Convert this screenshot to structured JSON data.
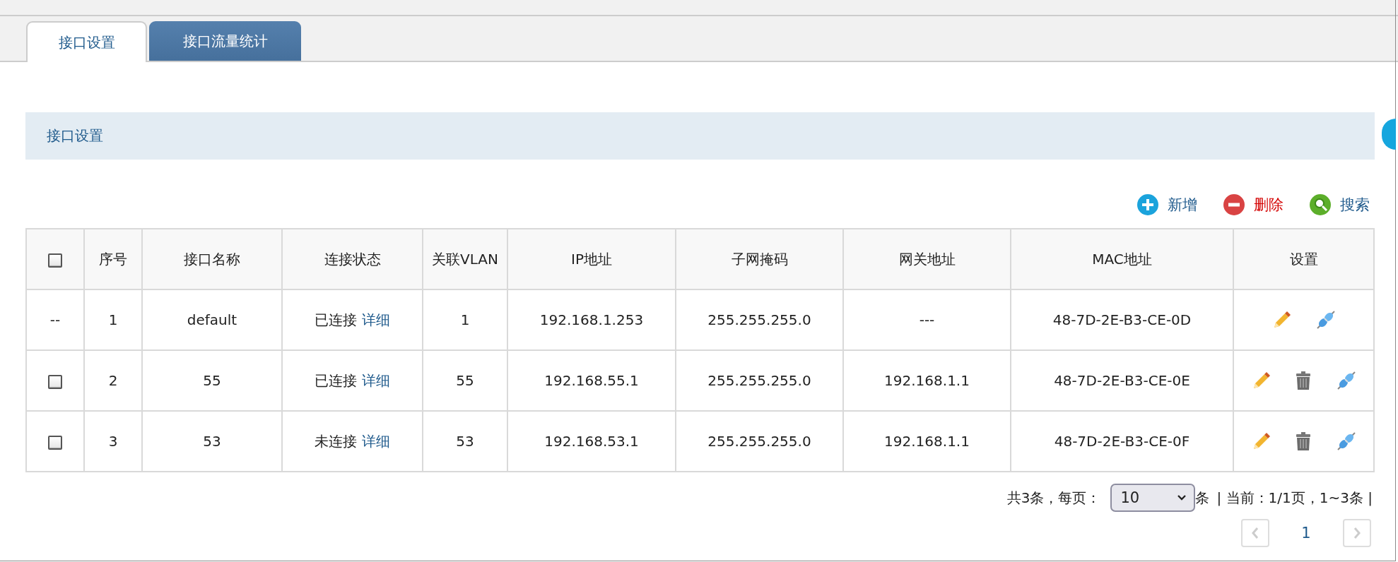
{
  "tabs": [
    {
      "label": "接口设置",
      "selected": true
    },
    {
      "label": "接口流量统计",
      "selected": false
    }
  ],
  "section": {
    "title": "接口设置"
  },
  "toolbar": [
    {
      "kind": "add",
      "label": "新增"
    },
    {
      "kind": "delete",
      "label": "删除"
    },
    {
      "kind": "search",
      "label": "搜索"
    }
  ],
  "table": {
    "header_checked": false,
    "columns": [
      "序号",
      "接口名称",
      "连接状态",
      "关联VLAN",
      "IP地址",
      "子网掩码",
      "网关地址",
      "MAC地址",
      "设置"
    ],
    "rows": [
      {
        "select_text": "--",
        "index": "1",
        "name": "default",
        "status": "已连接",
        "detail": "详细",
        "vlan": "1",
        "ip": "192.168.1.253",
        "mask": "255.255.255.0",
        "gateway": "---",
        "mac": "48-7D-2E-B3-CE-0D",
        "deletable": false
      },
      {
        "checked": false,
        "index": "2",
        "name": "55",
        "status": "已连接",
        "detail": "详细",
        "vlan": "55",
        "ip": "192.168.55.1",
        "mask": "255.255.255.0",
        "gateway": "192.168.1.1",
        "mac": "48-7D-2E-B3-CE-0E",
        "deletable": true
      },
      {
        "checked": false,
        "index": "3",
        "name": "53",
        "status": "未连接",
        "detail": "详细",
        "vlan": "53",
        "ip": "192.168.53.1",
        "mask": "255.255.255.0",
        "gateway": "192.168.1.1",
        "mac": "48-7D-2E-B3-CE-0F",
        "deletable": true
      }
    ]
  },
  "pagination": {
    "total": "共3条，每页：",
    "page_size": "10",
    "unit": "条",
    "current": "| 当前：1/1页，1~3条 |",
    "page": "1",
    "prev_disabled": true,
    "next_disabled": true
  }
}
